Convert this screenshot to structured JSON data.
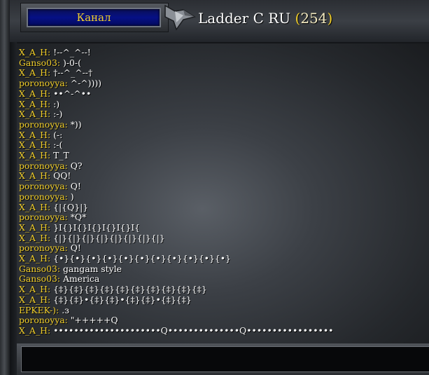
{
  "header": {
    "channel_button_label": "Канал",
    "channel_name": "Ladder C RU",
    "open_paren": "(",
    "user_count": "254",
    "close_paren": ")"
  },
  "colors": {
    "username": "#f2cf2a",
    "message": "#ffffff",
    "button_bg": "#061086"
  },
  "chat": {
    "messages": [
      {
        "user": "X_A_H",
        "text": "!--^_^--!"
      },
      {
        "user": "Ganso03",
        "text": ")-0-("
      },
      {
        "user": "X_A_H",
        "text": "†--^_^--†"
      },
      {
        "user": "poronoyya",
        "text": "^-^))))"
      },
      {
        "user": "X_A_H",
        "text": "••^-^••"
      },
      {
        "user": "X_A_H",
        "text": ":)"
      },
      {
        "user": "X_A_H",
        "text": ":-)"
      },
      {
        "user": "poronoyya",
        "text": "*))"
      },
      {
        "user": "X_A_H",
        "text": "(-:"
      },
      {
        "user": "X_A_H",
        "text": ":-("
      },
      {
        "user": "X_A_H",
        "text": "T_T"
      },
      {
        "user": "poronoyya",
        "text": "Q?"
      },
      {
        "user": "X_A_H",
        "text": "QQ!"
      },
      {
        "user": "poronoyya",
        "text": "Q!"
      },
      {
        "user": "poronoyya",
        "text": ")"
      },
      {
        "user": "X_A_H",
        "text": "{|{Q}|}"
      },
      {
        "user": "poronoyya",
        "text": "*Q*"
      },
      {
        "user": "X_A_H",
        "text": "}I{}I{}I{}I{}I{}I{"
      },
      {
        "user": "X_A_H",
        "text": "{|}{|}{|}{|}{|}{|}{|}{|}"
      },
      {
        "user": "poronoyya",
        "text": "Q!"
      },
      {
        "user": "X_A_H",
        "text": "{•}{•}{•}{•}{•}{•}{•}{•}{•}{•}{•}"
      },
      {
        "user": "Ganso03",
        "text": "gangam style"
      },
      {
        "user": "Ganso03",
        "text": "America"
      },
      {
        "user": "X_A_H",
        "text": "{‡}{‡}{‡}{‡}{‡}{‡}{‡}{‡}{‡}{‡}"
      },
      {
        "user": "X_A_H",
        "text": "{‡}{‡}•{‡}{‡}•{‡}{‡}•{‡}{‡}"
      },
      {
        "user": "EPKEK-)",
        "text": ".з"
      },
      {
        "user": "poronoyya",
        "text": "\"+++++Q"
      },
      {
        "user": "X_A_H",
        "text": "•••••••••••••••••••••Q••••••••••••••Q•••••••••••••••••"
      }
    ]
  },
  "input": {
    "value": ""
  }
}
